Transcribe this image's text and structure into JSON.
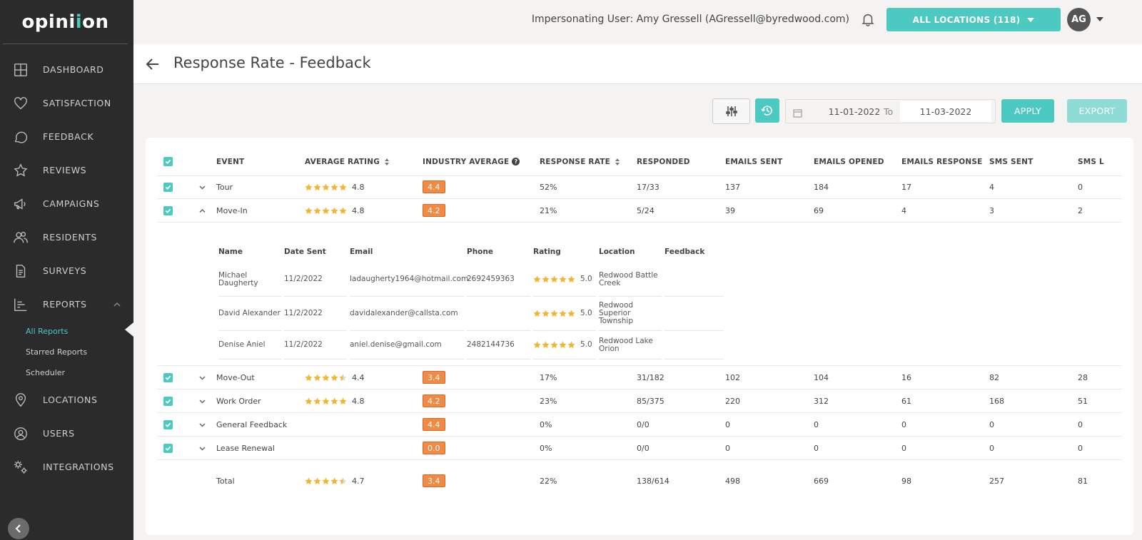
{
  "brand": {
    "logo_prefix": "opini",
    "logo_mid": "i",
    "logo_suffix": "on"
  },
  "sidebar": {
    "items": [
      {
        "label": "DASHBOARD"
      },
      {
        "label": "SATISFACTION"
      },
      {
        "label": "FEEDBACK"
      },
      {
        "label": "REVIEWS"
      },
      {
        "label": "CAMPAIGNS"
      },
      {
        "label": "RESIDENTS"
      },
      {
        "label": "SURVEYS"
      },
      {
        "label": "REPORTS"
      },
      {
        "label": "LOCATIONS"
      },
      {
        "label": "USERS"
      },
      {
        "label": "INTEGRATIONS"
      }
    ],
    "sub_items": [
      {
        "label": "All Reports"
      },
      {
        "label": "Starred Reports"
      },
      {
        "label": "Scheduler"
      }
    ]
  },
  "topbar": {
    "impersonating": "Impersonating User: Amy Gressell (AGressell@byredwood.com)",
    "locations_button": "ALL LOCATIONS (118)",
    "avatar_initials": "AG"
  },
  "page": {
    "title": "Response Rate - Feedback"
  },
  "toolbar": {
    "date_from": "11-01-2022",
    "to_label": "To",
    "date_to": "11-03-2022",
    "apply": "APPLY",
    "export": "EXPORT"
  },
  "table": {
    "headers": {
      "event": "EVENT",
      "avg_rating": "AVERAGE RATING",
      "industry_avg": "INDUSTRY AVERAGE",
      "response_rate": "RESPONSE RATE",
      "responded": "RESPONDED",
      "emails_sent": "EMAILS SENT",
      "emails_opened": "EMAILS OPENED",
      "emails_response": "EMAILS RESPONSE",
      "sms_sent": "SMS SENT",
      "sms_l": "SMS L"
    },
    "rows": [
      {
        "event": "Tour",
        "stars": 5,
        "rating": "4.8",
        "industry": "4.4",
        "rate": "52%",
        "responded": "17/33",
        "emails_sent": "137",
        "emails_opened": "184",
        "emails_response": "17",
        "sms_sent": "4",
        "sms_l": "0"
      },
      {
        "event": "Move-In",
        "stars": 5,
        "rating": "4.8",
        "industry": "4.2",
        "rate": "21%",
        "responded": "5/24",
        "emails_sent": "39",
        "emails_opened": "69",
        "emails_response": "4",
        "sms_sent": "3",
        "sms_l": "2"
      },
      {
        "event": "Move-Out",
        "stars": 4.5,
        "rating": "4.4",
        "industry": "3.4",
        "rate": "17%",
        "responded": "31/182",
        "emails_sent": "102",
        "emails_opened": "104",
        "emails_response": "16",
        "sms_sent": "82",
        "sms_l": "28"
      },
      {
        "event": "Work Order",
        "stars": 5,
        "rating": "4.8",
        "industry": "4.2",
        "rate": "23%",
        "responded": "85/375",
        "emails_sent": "220",
        "emails_opened": "312",
        "emails_response": "61",
        "sms_sent": "168",
        "sms_l": "51"
      },
      {
        "event": "General Feedback",
        "stars": 0,
        "rating": "",
        "industry": "4.4",
        "rate": "0%",
        "responded": "0/0",
        "emails_sent": "0",
        "emails_opened": "0",
        "emails_response": "0",
        "sms_sent": "0",
        "sms_l": "0"
      },
      {
        "event": "Lease Renewal",
        "stars": 0,
        "rating": "",
        "industry": "0.0",
        "rate": "0%",
        "responded": "0/0",
        "emails_sent": "0",
        "emails_opened": "0",
        "emails_response": "0",
        "sms_sent": "0",
        "sms_l": "0"
      }
    ],
    "total": {
      "event": "Total",
      "stars": 4.5,
      "rating": "4.7",
      "industry": "3.4",
      "rate": "22%",
      "responded": "138/614",
      "emails_sent": "498",
      "emails_opened": "669",
      "emails_response": "98",
      "sms_sent": "257",
      "sms_l": "81"
    }
  },
  "detail": {
    "headers": {
      "name": "Name",
      "date_sent": "Date Sent",
      "email": "Email",
      "phone": "Phone",
      "rating": "Rating",
      "location": "Location",
      "feedback": "Feedback"
    },
    "rows": [
      {
        "name": "Michael Daugherty",
        "date_sent": "11/2/2022",
        "email": "ladaugherty1964@hotmail.com",
        "phone": "2692459363",
        "rating": "5.0",
        "location": "Redwood Battle Creek",
        "feedback": ""
      },
      {
        "name": "David Alexander",
        "date_sent": "11/2/2022",
        "email": "davidalexander@callsta.com",
        "phone": "",
        "rating": "5.0",
        "location": "Redwood Superior Township",
        "feedback": ""
      },
      {
        "name": "Denise Aniel",
        "date_sent": "11/2/2022",
        "email": "aniel.denise@gmail.com",
        "phone": "2482144736",
        "rating": "5.0",
        "location": "Redwood Lake Orion",
        "feedback": ""
      }
    ]
  },
  "colors": {
    "accent": "#4cc9c0",
    "badge": "#f08a45",
    "star": "#f2b632",
    "sidebar": "#2b2b2b"
  }
}
